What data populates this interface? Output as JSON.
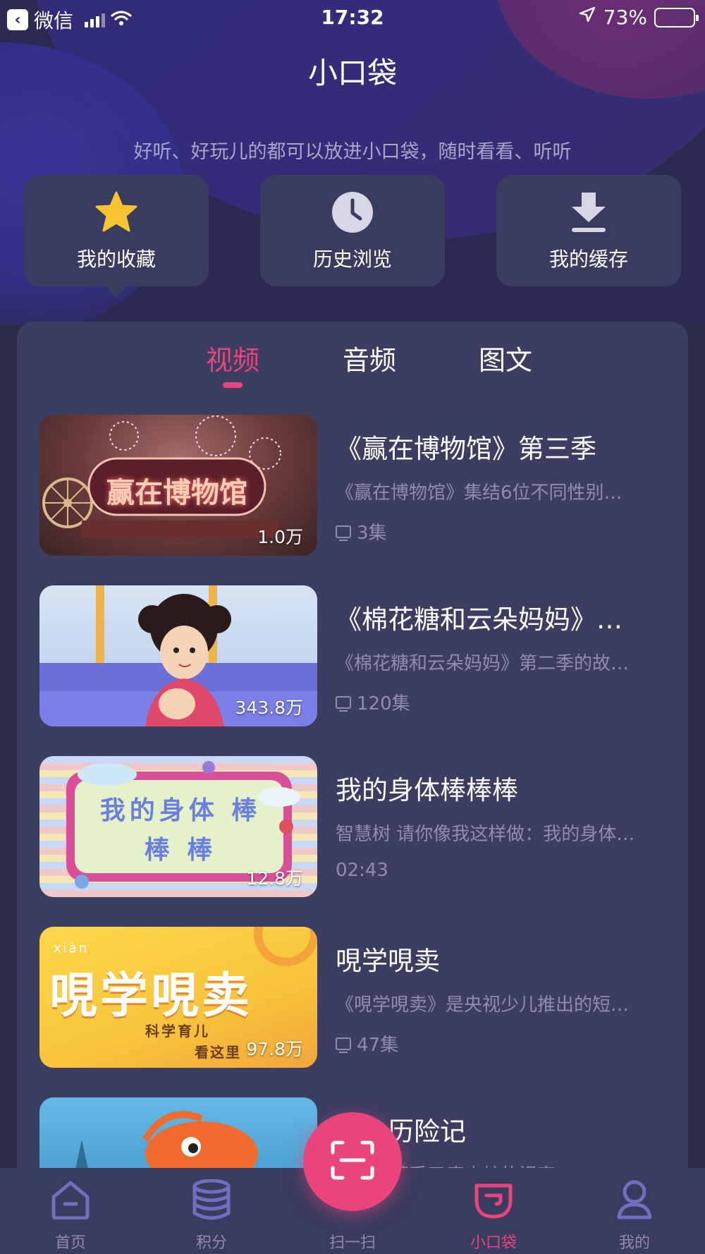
{
  "status_bar": {
    "back_app": "微信",
    "time": "17:32",
    "battery": "73%"
  },
  "header": {
    "title": "小口袋",
    "subtitle": "好听、好玩儿的都可以放进小口袋，随时看看、听听"
  },
  "quick_actions": [
    {
      "label": "我的收藏",
      "icon": "star-icon"
    },
    {
      "label": "历史浏览",
      "icon": "clock-icon"
    },
    {
      "label": "我的缓存",
      "icon": "download-icon"
    }
  ],
  "tabs": [
    {
      "label": "视频",
      "active": true
    },
    {
      "label": "音频",
      "active": false
    },
    {
      "label": "图文",
      "active": false
    }
  ],
  "items": [
    {
      "title": "《赢在博物馆》第三季",
      "desc": "《赢在博物馆》集结6位不同性别…",
      "meta": "3集",
      "views": "1.0万",
      "thumb_text": "赢在博物馆"
    },
    {
      "title": "《棉花糖和云朵妈妈》…",
      "desc": "《棉花糖和云朵妈妈》第二季的故…",
      "meta": "120集",
      "views": "343.8万",
      "thumb_text": ""
    },
    {
      "title": "我的身体棒棒棒",
      "desc": "智慧树 请你像我这样做：我的身体…",
      "meta": "02:43",
      "views": "12.8万",
      "thumb_text": "我的身体 棒 棒 棒"
    },
    {
      "title": "哯学哯卖",
      "desc": "《哯学哯卖》是央视少儿推出的短…",
      "meta": "47集",
      "views": "97.8万",
      "thumb_text": "哯学哯卖",
      "thumb_pinyin": "xiàn",
      "thumb_sub": "科学育儿",
      "thumb_sub2": "看这里"
    },
    {
      "title": "鲤鱼历险记",
      "desc": "鲤鱼湖遭受了癞皮蛇的祸害",
      "meta": "",
      "views": "",
      "thumb_text": ""
    }
  ],
  "bottom_nav": [
    {
      "label": "首页",
      "icon": "home-icon"
    },
    {
      "label": "积分",
      "icon": "coins-icon"
    },
    {
      "label": "扫一扫",
      "icon": "scan-icon"
    },
    {
      "label": "小口袋",
      "icon": "pocket-icon",
      "active": true
    },
    {
      "label": "我的",
      "icon": "user-icon"
    }
  ],
  "colors": {
    "accent": "#e9457c",
    "background": "#2b2c4a",
    "card": "#393b5f",
    "muted_text": "#8e8daf"
  }
}
